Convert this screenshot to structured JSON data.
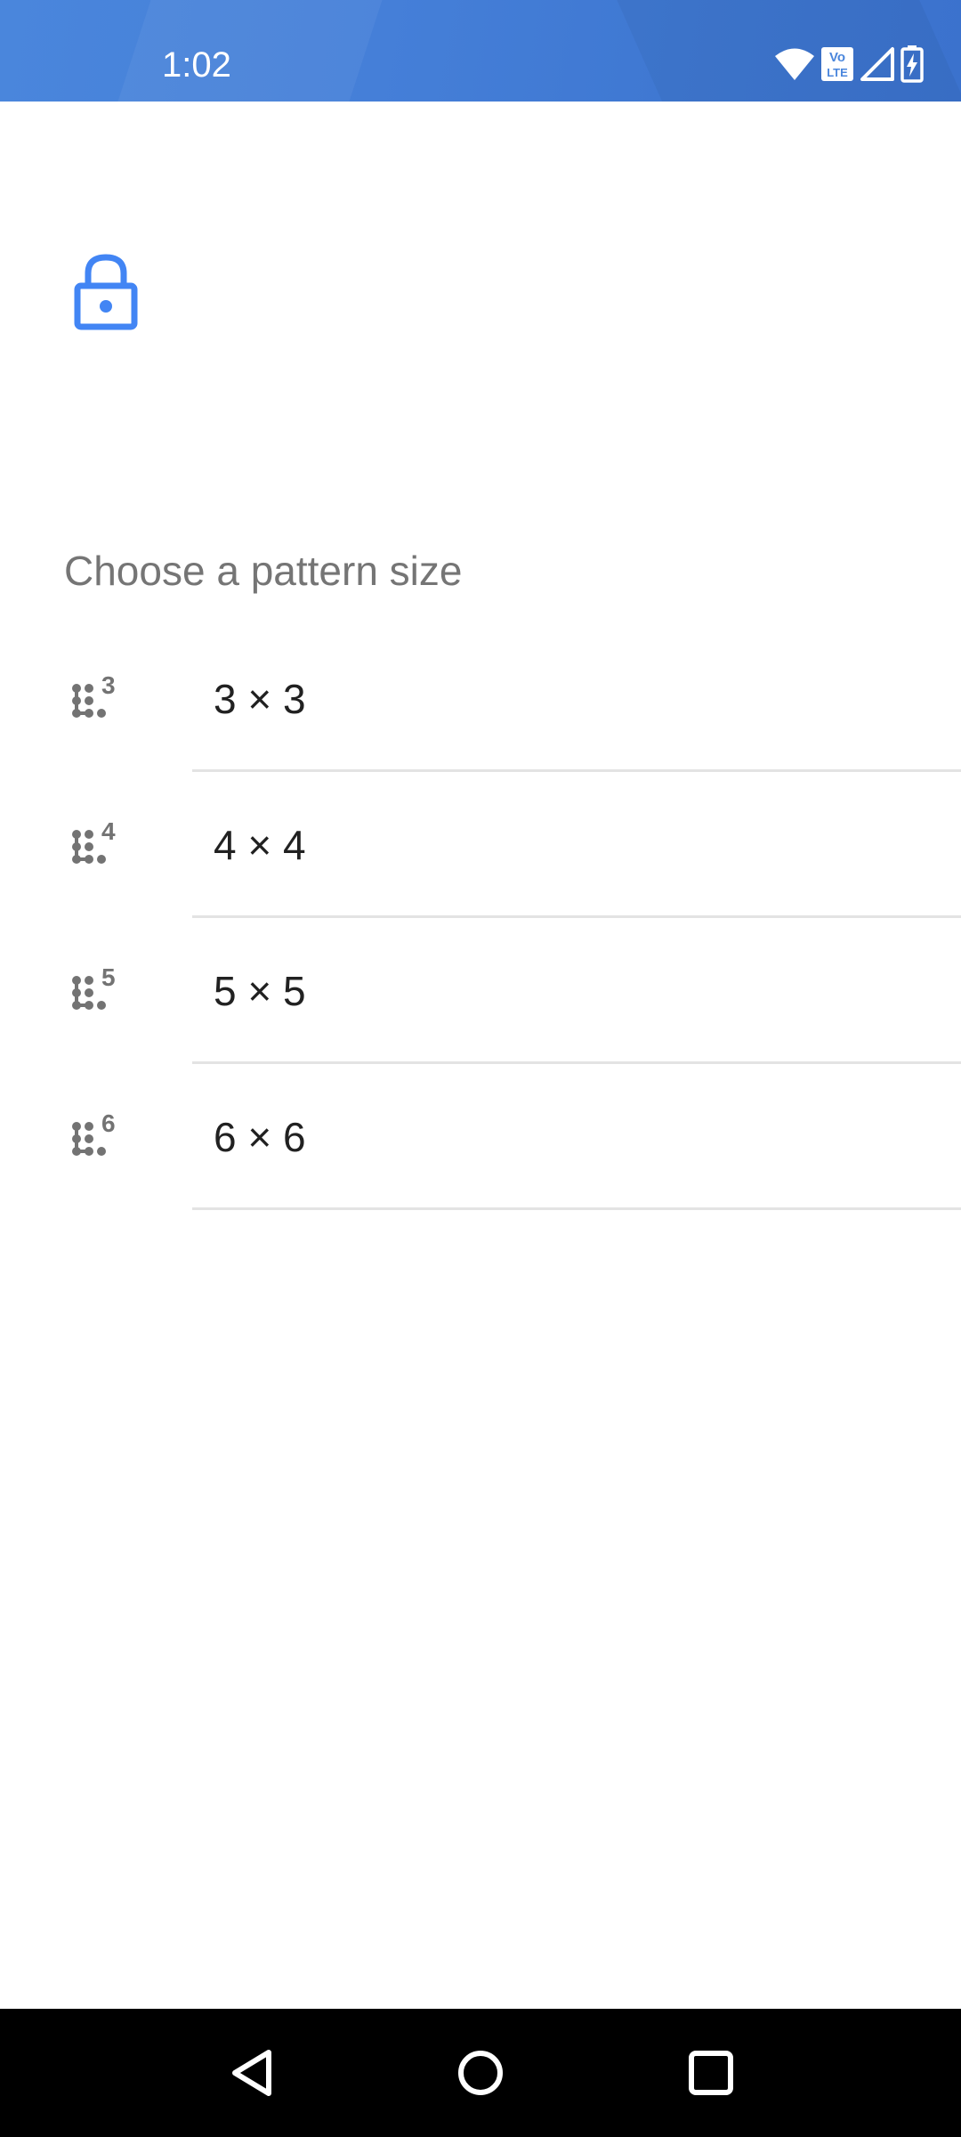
{
  "status_bar": {
    "time": "1:02",
    "icons": [
      "wifi-icon",
      "volte-icon",
      "signal-icon",
      "battery-charging-icon"
    ],
    "volte_top": "Vo",
    "volte_bottom": "LTE"
  },
  "header": {
    "icon": "lock-icon",
    "accent_color": "#4285f4"
  },
  "main": {
    "title": "Choose a pattern size",
    "options": [
      {
        "label": "3 × 3",
        "icon_digit": "3",
        "icon": "pattern-3-icon"
      },
      {
        "label": "4 × 4",
        "icon_digit": "4",
        "icon": "pattern-4-icon"
      },
      {
        "label": "5 × 5",
        "icon_digit": "5",
        "icon": "pattern-5-icon"
      },
      {
        "label": "6 × 6",
        "icon_digit": "6",
        "icon": "pattern-6-icon"
      }
    ]
  },
  "nav_bar": {
    "buttons": [
      "back-icon",
      "home-icon",
      "recents-icon"
    ]
  }
}
